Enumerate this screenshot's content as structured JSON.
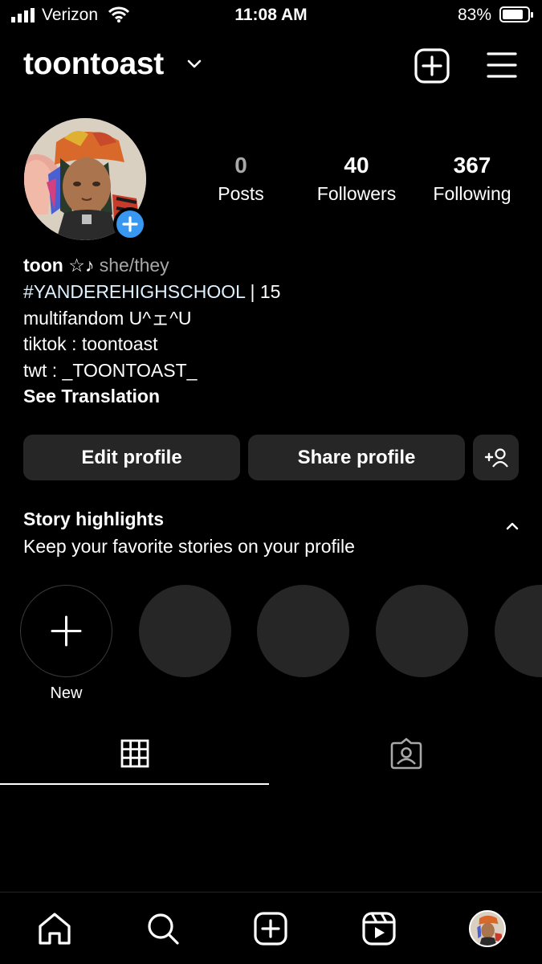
{
  "status_bar": {
    "carrier": "Verizon",
    "time": "11:08 AM",
    "battery_percent": "83%",
    "battery_level": 0.83
  },
  "header": {
    "username": "toontoast"
  },
  "profile": {
    "stats": [
      {
        "value": "0",
        "label": "Posts"
      },
      {
        "value": "40",
        "label": "Followers"
      },
      {
        "value": "367",
        "label": "Following"
      }
    ],
    "name": "toon ☆♪",
    "pronouns": "she/they",
    "bio_hashtag": "#YANDEREHIGHSCHOOL",
    "bio_hashtag_suffix": " | 15",
    "bio_line2": "multifandom U^ェ^U",
    "bio_line3": "tiktok : toontoast",
    "bio_line4": "twt : _TOONTOAST_",
    "see_translation": "See Translation"
  },
  "actions": {
    "edit_profile": "Edit profile",
    "share_profile": "Share profile"
  },
  "highlights": {
    "title": "Story highlights",
    "subtitle": "Keep your favorite stories on your profile",
    "new_label": "New"
  },
  "icons": {
    "header": [
      "chevron-down-icon",
      "new-post-icon",
      "menu-icon"
    ],
    "tabs": [
      "grid-icon",
      "tagged-icon"
    ],
    "bottom_nav": [
      "home-icon",
      "search-icon",
      "create-icon",
      "reels-icon",
      "profile-avatar"
    ]
  },
  "colors": {
    "background": "#000000",
    "button_bg": "#262626",
    "accent_blue": "#3897f0"
  }
}
